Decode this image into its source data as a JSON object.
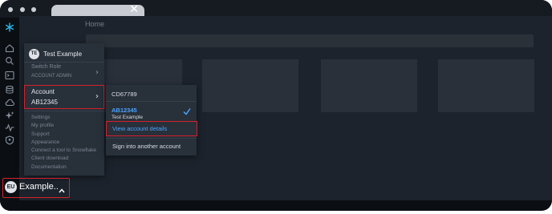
{
  "breadcrumb": "Home",
  "profile_menu": {
    "initials": "TE",
    "name": "Test Example",
    "switch_role_label": "Switch Role",
    "role_value": "ACCOUNT ADMIN",
    "account_label": "Account",
    "account_value": "AB12345",
    "items": [
      "Settings",
      "My profile",
      "Support",
      "Appearance",
      "Connect a tool to Snowflake",
      "Client download",
      "Documentation"
    ]
  },
  "account_submenu": {
    "other_account": "CD67789",
    "active_account": "AB12345",
    "active_account_name": "Test Example",
    "view_details": "View account details",
    "sign_in_other": "Sign into another account"
  },
  "user_button": {
    "initials": "EU",
    "name": "Example.."
  },
  "sidebar_icons": [
    "snowflake-logo",
    "home-icon",
    "search-icon",
    "worksheets-icon",
    "database-icon",
    "cloud-icon",
    "ai-sparkle-icon",
    "activity-icon",
    "admin-shield-icon"
  ],
  "colors": {
    "accent_blue": "#4aa3ff",
    "highlight_red": "#d6202b",
    "menu_bg": "#28303a",
    "content_bg": "#1c232c"
  }
}
